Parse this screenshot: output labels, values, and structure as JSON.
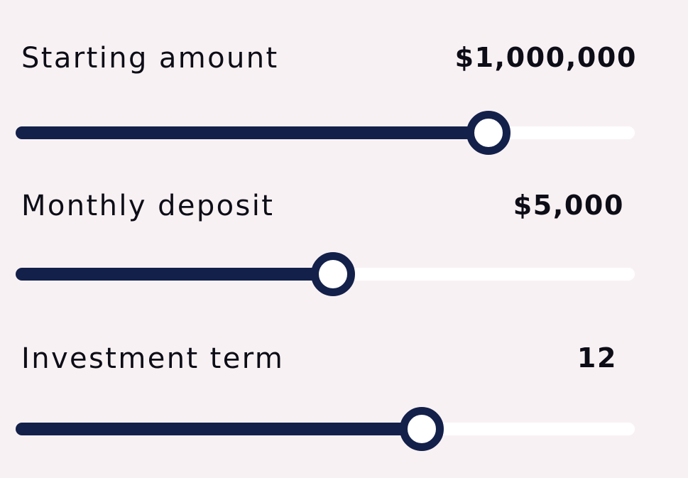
{
  "colors": {
    "background": "#f8f1f3",
    "track_fill": "#13204a",
    "track_empty": "#ffffff",
    "text": "#0d0d17"
  },
  "sliders": [
    {
      "label": "Starting amount",
      "value": "$1,000,000",
      "position_fraction": 0.764
    },
    {
      "label": "Monthly deposit",
      "value": "$5,000",
      "position_fraction": 0.513
    },
    {
      "label": "Investment term",
      "value": "12",
      "position_fraction": 0.656
    }
  ]
}
